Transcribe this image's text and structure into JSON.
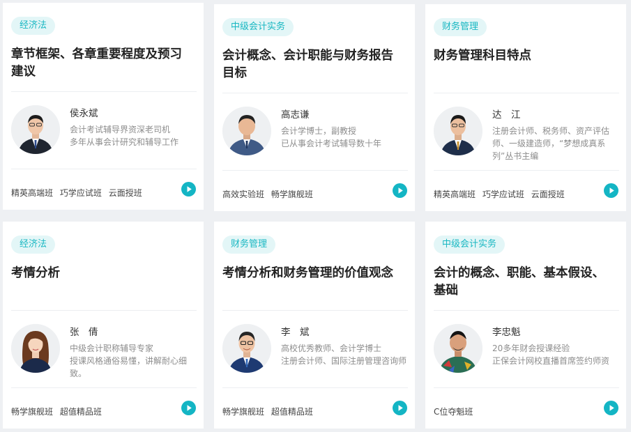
{
  "cards": [
    {
      "tag": "经济法",
      "title": "章节框架、各章重要程度及预习建议",
      "teacher": "侯永斌",
      "desc": [
        "会计考试辅导界资深老司机",
        "多年从事会计研究和辅导工作"
      ],
      "courses": [
        "精英高端班",
        "巧学应试班",
        "云面授班"
      ]
    },
    {
      "tag": "中级会计实务",
      "title": "会计概念、会计职能与财务报告目标",
      "teacher": "高志谦",
      "desc": [
        "会计学博士，副教授",
        "已从事会计考试辅导数十年"
      ],
      "courses": [
        "高效实验班",
        "畅学旗舰班"
      ]
    },
    {
      "tag": "财务管理",
      "title": "财务管理科目特点",
      "teacher": "达　江",
      "desc": [
        "注册会计师、税务师、资产评估师、一级建造师，“梦想成真系列”丛书主编"
      ],
      "courses": [
        "精英高端班",
        "巧学应试班",
        "云面授班"
      ]
    },
    {
      "tag": "经济法",
      "title": "考情分析",
      "teacher": "张　倩",
      "desc": [
        "中级会计职称辅导专家",
        "授课风格通俗易懂，讲解耐心细致。"
      ],
      "courses": [
        "畅学旗舰班",
        "超值精品班"
      ]
    },
    {
      "tag": "财务管理",
      "title": "考情分析和财务管理的价值观念",
      "teacher": "李　斌",
      "desc": [
        "高校优秀教师、会计学博士",
        "注册会计师、国际注册管理咨询师"
      ],
      "courses": [
        "畅学旗舰班",
        "超值精品班"
      ]
    },
    {
      "tag": "中级会计实务",
      "title": "会计的概念、职能、基本假设、基础",
      "teacher": "李忠魁",
      "desc": [
        "20多年财会授课经验",
        "正保会计网校直播首席签约师资"
      ],
      "courses": [
        "C位夺魁班"
      ]
    }
  ],
  "icons": {
    "play": "play-circle-icon",
    "avatar": "teacher-avatar-icon"
  },
  "colors": {
    "accent": "#14b5c4",
    "tag_bg": "#e3f6f7",
    "page_bg": "#eef0f3"
  }
}
